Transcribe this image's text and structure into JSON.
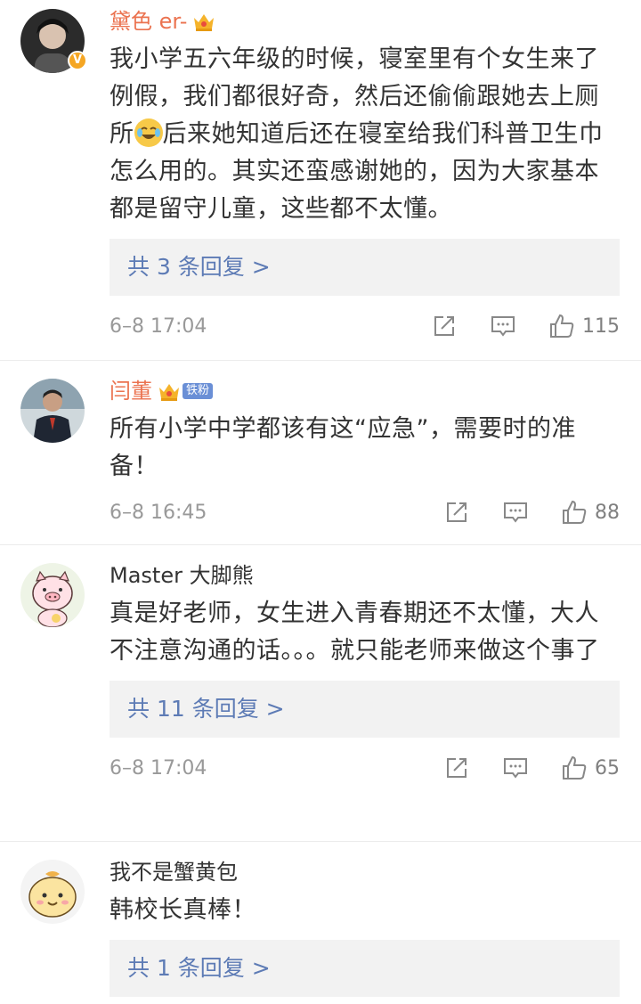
{
  "comments": [
    {
      "username": "黛色 er-",
      "text_before": "我小学五六年级的时候，寝室里有个女生来了例假，我们都很好奇，然后还偷偷跟她去上厕所",
      "text_after": "后来她知道后还在寝室给我们科普卫生巾怎么用的。其实还蛮感谢她的，因为大家基本都是留守儿童，这些都不太懂。",
      "replies": "共 3 条回复 >",
      "time": "6–8 17:04",
      "likes": "115"
    },
    {
      "username": "闫董",
      "badge": "铁粉",
      "text": "所有小学中学都该有这“应急”，需要时的准备！",
      "time": "6–8 16:45",
      "likes": "88"
    },
    {
      "username": "Master 大脚熊",
      "text": "真是好老师，女生进入青春期还不太懂，大人不注意沟通的话。。。就只能老师来做这个事了",
      "replies": "共 11 条回复 >",
      "time": "6–8 17:04",
      "likes": "65"
    },
    {
      "username": "我不是蟹黄包",
      "text": "韩校长真棒！",
      "replies": "共 1 条回复 >"
    }
  ],
  "colors": {
    "username_highlight": "#eb7350",
    "reply_link": "#5d7bb5",
    "reply_bg": "#f2f2f2"
  },
  "icons": {
    "share": "share-icon",
    "comment": "comment-icon",
    "like": "thumbs-up-icon"
  }
}
